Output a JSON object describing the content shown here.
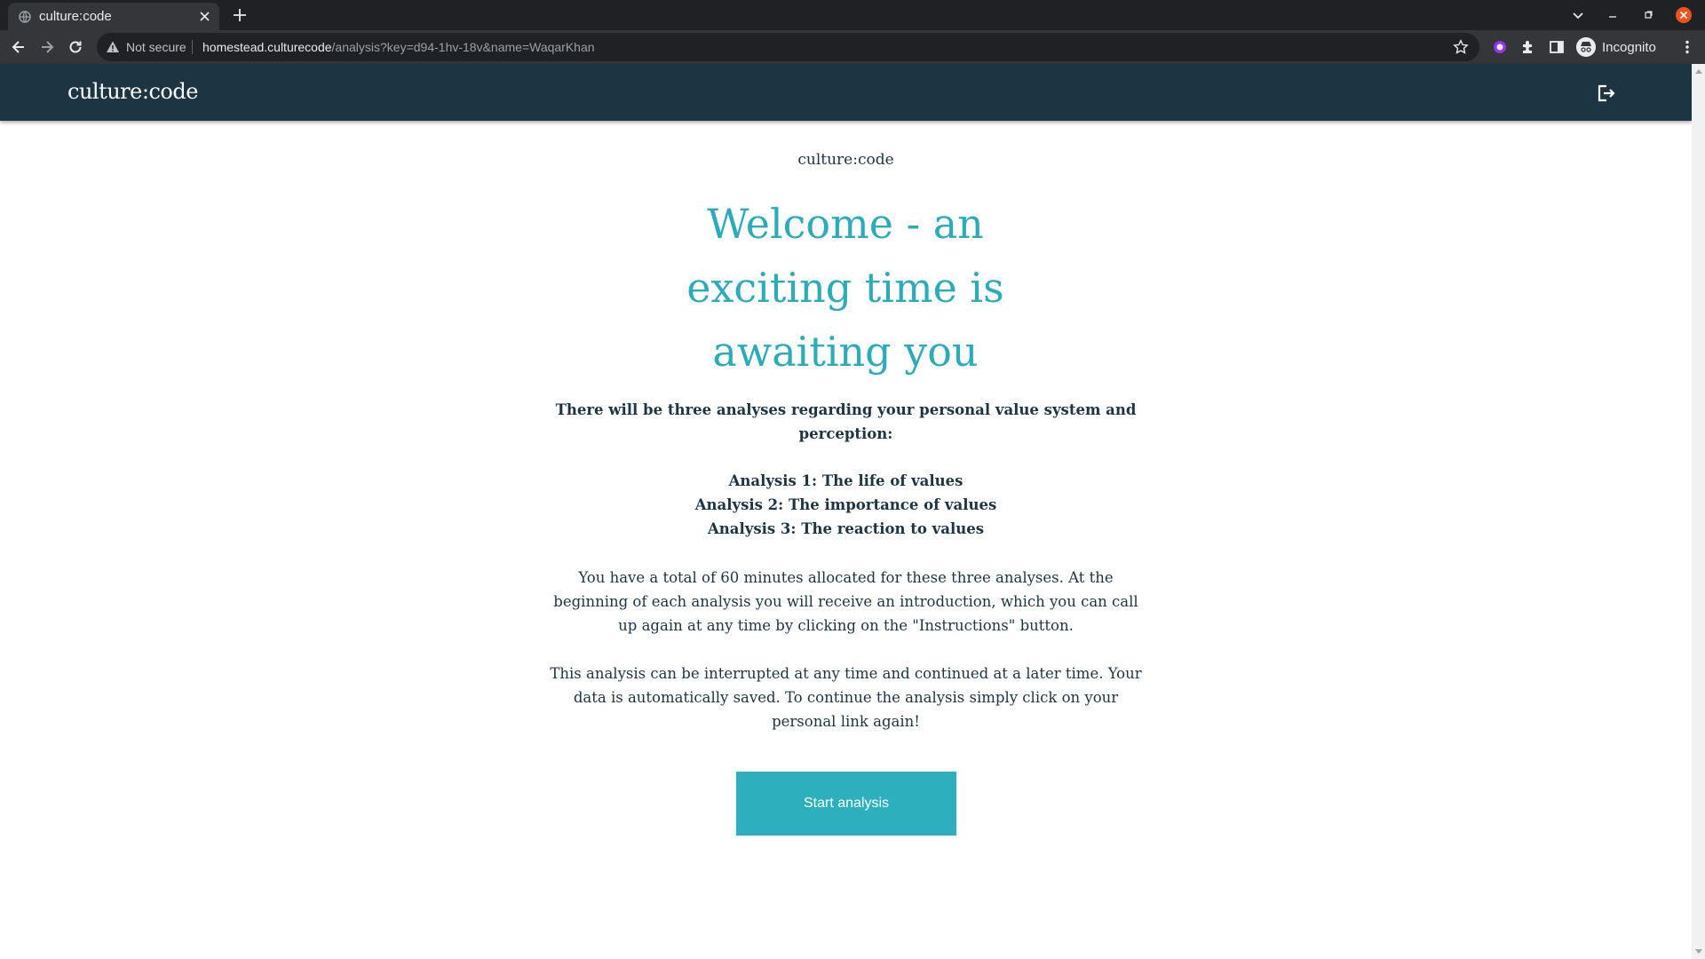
{
  "browser": {
    "tab_title": "culture:code",
    "security_label": "Not secure",
    "url_host": "homestead.culturecode",
    "url_path": "/analysis?key=d94-1hv-18v&name=WaqarKhan",
    "incognito_label": "Incognito"
  },
  "header": {
    "logo": "culture:code"
  },
  "main": {
    "brand": "culture:code",
    "headline": "Welcome - an exciting time is awaiting you",
    "intro": "There will be three analyses regarding your personal value system and perception:",
    "analyses": [
      "Analysis 1: The life of values",
      "Analysis 2: The importance of values",
      "Analysis 3: The reaction to values"
    ],
    "paragraph_time": "You have a total of 60 minutes allocated for these three analyses. At the beginning of each analysis you will receive an introduction, which you can call up again at any time by clicking on the \"Instructions\" button.",
    "paragraph_interrupt": "This analysis can be interrupted at any time and continued at a later time. Your data is automatically saved. To continue the analysis simply click on your personal link again!",
    "start_button": "Start analysis"
  },
  "colors": {
    "header_bg": "#1d3442",
    "accent": "#2eabb8",
    "text": "#1d3442"
  }
}
